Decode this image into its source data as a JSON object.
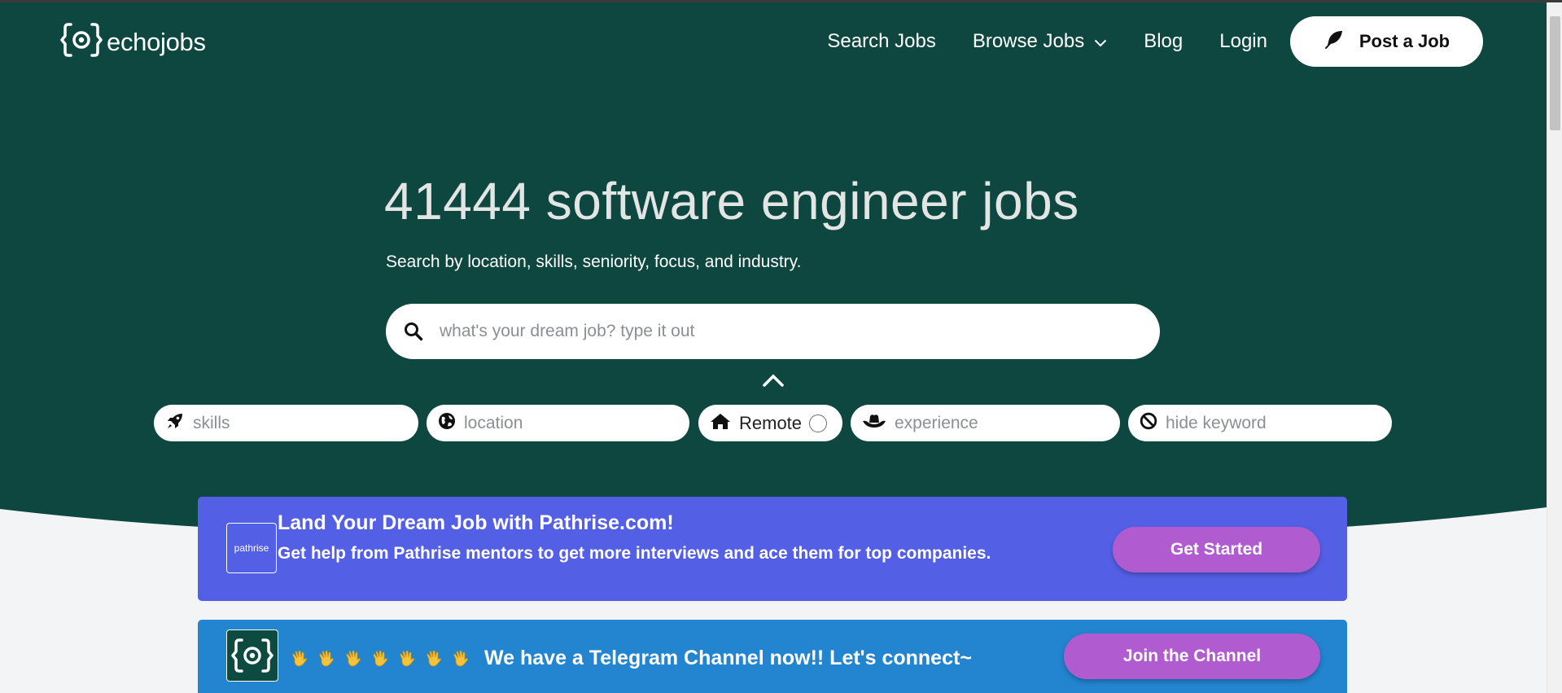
{
  "header": {
    "logo_text": "echojobs",
    "nav": {
      "search_jobs": "Search Jobs",
      "browse_jobs": "Browse Jobs",
      "blog": "Blog",
      "login": "Login"
    },
    "post_job_label": "Post a Job"
  },
  "hero": {
    "headline": "41444 software engineer jobs",
    "subline": "Search by location, skills, seniority, focus, and industry.",
    "search_placeholder": "what's your dream job? type it out"
  },
  "filters": {
    "skills_placeholder": "skills",
    "location_placeholder": "location",
    "remote_label": "Remote",
    "remote_checked": false,
    "experience_placeholder": "experience",
    "hide_keyword_placeholder": "hide keyword"
  },
  "banners": {
    "pathrise": {
      "logo_text": "pathrise",
      "title": "Land Your Dream Job with Pathrise.com!",
      "desc": "Get help from Pathrise mentors to get more interviews and ace them for top companies.",
      "button": "Get Started"
    },
    "telegram": {
      "message": "We have a Telegram Channel now!! Let's connect~",
      "wave_count": 7,
      "button": "Join the Channel"
    }
  },
  "colors": {
    "hero_bg": "#0d4740",
    "page_bg": "#f3f4f6",
    "pathrise_banner": "#5360e6",
    "telegram_banner": "#2384cf",
    "pill_button": "#b05bd0"
  },
  "icons": [
    "echojobs-logo-icon",
    "chevron-down-icon",
    "feather-icon",
    "search-icon",
    "chevron-up-icon",
    "rocket-icon",
    "globe-icon",
    "house-icon",
    "cowboy-hat-icon",
    "ban-icon",
    "waving-hand-icon"
  ]
}
